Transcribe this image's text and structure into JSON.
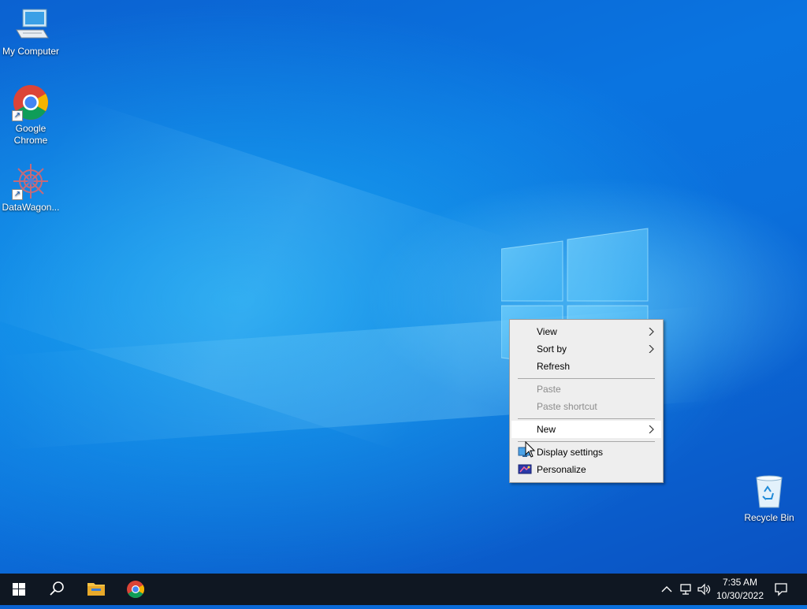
{
  "desktop": {
    "icons": [
      {
        "label": "My Computer"
      },
      {
        "label": "Google Chrome"
      },
      {
        "label": "DataWagon..."
      }
    ],
    "recycle_bin": {
      "label": "Recycle Bin"
    }
  },
  "context_menu": {
    "items": [
      {
        "label": "View",
        "submenu": true
      },
      {
        "label": "Sort by",
        "submenu": true
      },
      {
        "label": "Refresh"
      },
      {
        "label": "Paste",
        "disabled": true
      },
      {
        "label": "Paste shortcut",
        "disabled": true
      },
      {
        "label": "New",
        "submenu": true
      },
      {
        "label": "Display settings",
        "icon": "display-icon"
      },
      {
        "label": "Personalize",
        "icon": "personalize-icon"
      }
    ]
  },
  "taskbar": {
    "pinned": [
      {
        "icon": "windows-start-icon"
      },
      {
        "icon": "search-icon"
      },
      {
        "icon": "file-explorer-icon"
      },
      {
        "icon": "chrome-icon"
      }
    ],
    "clock": {
      "time": "7:35 AM",
      "date": "10/30/2022"
    },
    "tray_icons": [
      "chevron-up-icon",
      "network-icon",
      "volume-icon",
      "notification-icon"
    ]
  },
  "colors": {
    "taskbar_bg": "#0f1722",
    "menu_bg": "#eeeeee",
    "menu_hover": "#ffffff",
    "disabled_text": "#8c8c8c"
  }
}
